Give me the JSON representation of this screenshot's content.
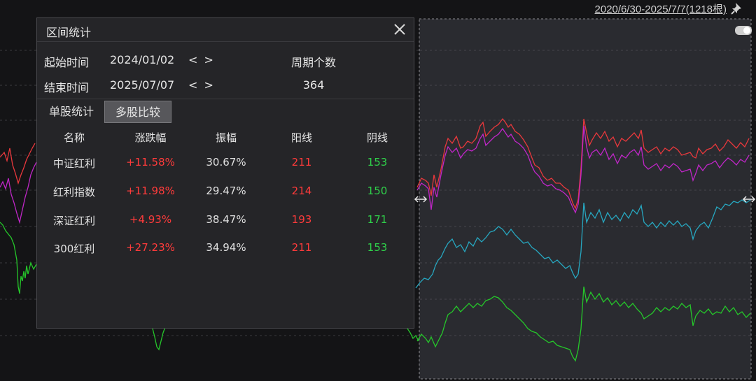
{
  "header": {
    "date_range": "2020/6/30-2025/7/7(1218根)"
  },
  "icons": {
    "pin": "pin-icon",
    "close": "close-icon",
    "toggle": "toggle-icon"
  },
  "colors": {
    "up": "#ff3b3b",
    "down": "#2fd04a",
    "line_red": "#e8383c",
    "line_magenta": "#c026c8",
    "line_cyan": "#27a7c0",
    "line_green": "#25c72a"
  },
  "panel": {
    "title": "区间统计",
    "start_label": "起始时间",
    "start_value": "2024/01/02",
    "end_label": "结束时间",
    "end_value": "2025/07/07",
    "nav": "< >",
    "period_label": "周期个数",
    "period_value": "364",
    "tabs": [
      "单股统计",
      "多股比较"
    ],
    "active_tab": "多股比较",
    "columns": [
      "名称",
      "涨跌幅",
      "振幅",
      "阳线",
      "阴线"
    ],
    "rows": [
      {
        "name": "中证红利",
        "change": "+11.58%",
        "amplitude": "30.67%",
        "up": "211",
        "down": "153"
      },
      {
        "name": "红利指数",
        "change": "+11.98%",
        "amplitude": "29.47%",
        "up": "214",
        "down": "150"
      },
      {
        "name": "深证红利",
        "change": "+4.93%",
        "amplitude": "38.47%",
        "up": "193",
        "down": "171"
      },
      {
        "name": "300红利",
        "change": "+27.23%",
        "amplitude": "34.94%",
        "up": "211",
        "down": "153"
      }
    ]
  }
}
